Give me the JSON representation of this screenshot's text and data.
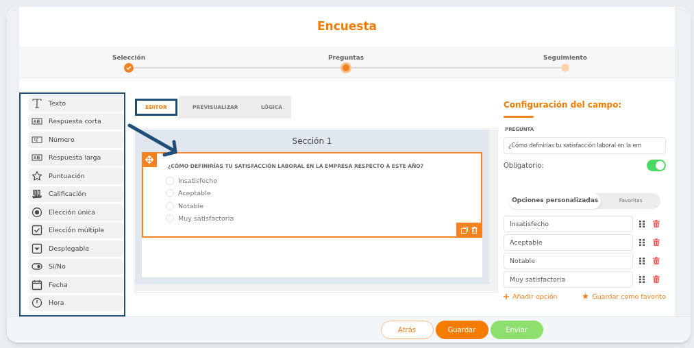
{
  "title": "Encuesta",
  "steps": [
    {
      "label": "Selección",
      "completed": true,
      "selected": false
    },
    {
      "label": "Preguntas",
      "completed": false,
      "selected": true
    },
    {
      "label": "Seguimiento",
      "completed": false,
      "selected": false
    }
  ],
  "field_types": [
    "Texto",
    "Respuesta corta",
    "Número",
    "Respuesta larga",
    "Puntuación",
    "Calificación",
    "Elección única",
    "Elección múltiple",
    "Desplegable",
    "Sí/No",
    "Fecha",
    "Hora"
  ],
  "tabs": [
    {
      "label": "EDITOR",
      "selected": true
    },
    {
      "label": "PREVISUALIZAR",
      "selected": false
    },
    {
      "label": "LÓGICA",
      "selected": false
    }
  ],
  "editor": {
    "section_title": "Sección 1",
    "question": "¿CÓMO DEFINIRÍAS TU SATISFACCIÓN LABORAL EN LA EMPRESA RESPECTO A ESTE AÑO?",
    "options": [
      {
        "label": "Insatisfecho",
        "checked": false
      },
      {
        "label": "Aceptable",
        "checked": false
      },
      {
        "label": "Notable",
        "checked": false
      },
      {
        "label": "Muy satisfactoria",
        "checked": false
      }
    ]
  },
  "config": {
    "title": "Configuración del campo:",
    "question_label": "PREGUNTA",
    "question_value": "¿Cómo definirías tu satisfacción laboral en la em",
    "required_label": "Obligatorio:",
    "required_on": true,
    "option_tabs": [
      {
        "label": "Opciones personalizadas",
        "selected": true
      },
      {
        "label": "Favoritas",
        "selected": false
      }
    ],
    "options": [
      "Insatisfecho",
      "Aceptable",
      "Notable",
      "Muy satisfactoria"
    ],
    "add_option": "Añadir opción",
    "save_favorite": "Guardar como favorito"
  },
  "buttons": [
    {
      "label": "Atrás",
      "kind": "outline"
    },
    {
      "label": "Guardar",
      "kind": "primary"
    },
    {
      "label": "Enviar",
      "kind": "success"
    }
  ]
}
